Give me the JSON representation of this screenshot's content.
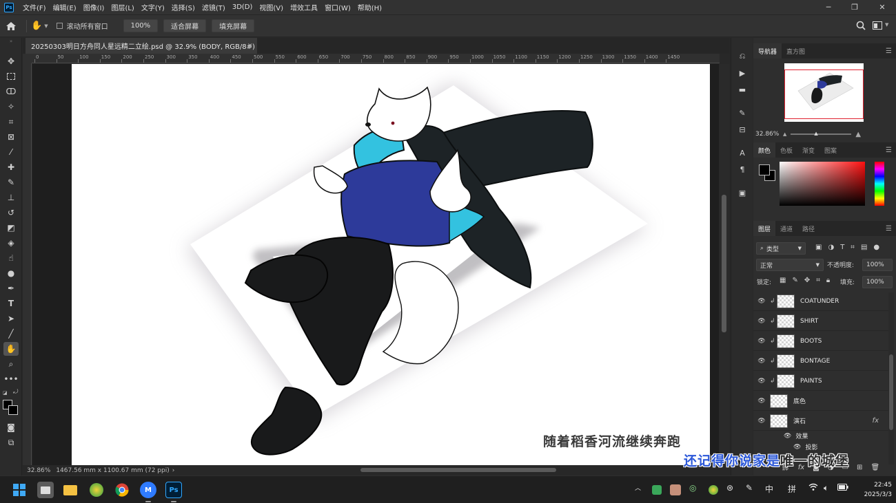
{
  "menu": {
    "items": [
      "文件(F)",
      "编辑(E)",
      "图像(I)",
      "图层(L)",
      "文字(Y)",
      "选择(S)",
      "滤镜(T)",
      "3D(D)",
      "视图(V)",
      "增效工具",
      "窗口(W)",
      "帮助(H)"
    ]
  },
  "options": {
    "scroll_all_label": "滚动所有窗口",
    "zoom_100": "100%",
    "fit_screen": "适合屏幕",
    "fill_screen": "填充屏幕"
  },
  "document": {
    "tab_title": "20250303明日方舟同人星远精二立绘.psd @ 32.9% (BODY, RGB/8#)",
    "close_glyph": "×"
  },
  "ruler": {
    "h_ticks": [
      "0",
      "50",
      "100",
      "150",
      "200",
      "250",
      "300",
      "350",
      "400",
      "450",
      "500",
      "550",
      "600",
      "650",
      "700",
      "750",
      "800",
      "850",
      "900",
      "950",
      "1000",
      "1050",
      "1100",
      "1150",
      "1200",
      "1250",
      "1300",
      "1350",
      "1400",
      "1450"
    ]
  },
  "status": {
    "zoom": "32.86%",
    "doc_size": "1467.56 mm x 1100.67 mm (72 ppi)",
    "arrow": "›"
  },
  "navigator": {
    "tab_navigator": "导航器",
    "tab_histogram": "直方图",
    "zoom_value": "32.86%"
  },
  "color_panel": {
    "tabs": [
      "颜色",
      "色板",
      "渐变",
      "图案"
    ]
  },
  "layers_panel": {
    "tabs": [
      "图层",
      "通道",
      "路径"
    ],
    "filter_kind": "类型",
    "blend_mode": "正常",
    "opacity_label": "不透明度:",
    "opacity_value": "100%",
    "lock_label": "锁定:",
    "fill_label": "填充:",
    "fill_value": "100%",
    "layers": [
      {
        "name": "COATUNDER",
        "clipped": true
      },
      {
        "name": "SHIRT",
        "clipped": true
      },
      {
        "name": "BOOTS",
        "clipped": true
      },
      {
        "name": "BONTAGE",
        "clipped": true
      },
      {
        "name": "PAINTS",
        "clipped": true
      },
      {
        "name": "底色",
        "clipped": false
      },
      {
        "name": "演石",
        "clipped": false,
        "fx": "fx"
      }
    ],
    "effects_label": "效果",
    "shadow_label": "投影"
  },
  "subtitles": {
    "line1": "随着稻香河流继续奔跑",
    "line2_hl": "还记得你说家是",
    "line2_rest": "唯一的城堡"
  },
  "taskbar": {
    "ime_lang": "中",
    "ime_mode": "拼",
    "time": "22:45",
    "date": "2025/3/3"
  },
  "colors": {
    "accent": "#31a8ff",
    "shirt": "#2d3a9a",
    "collar": "#33c2e0",
    "coat": "#1d2326"
  }
}
